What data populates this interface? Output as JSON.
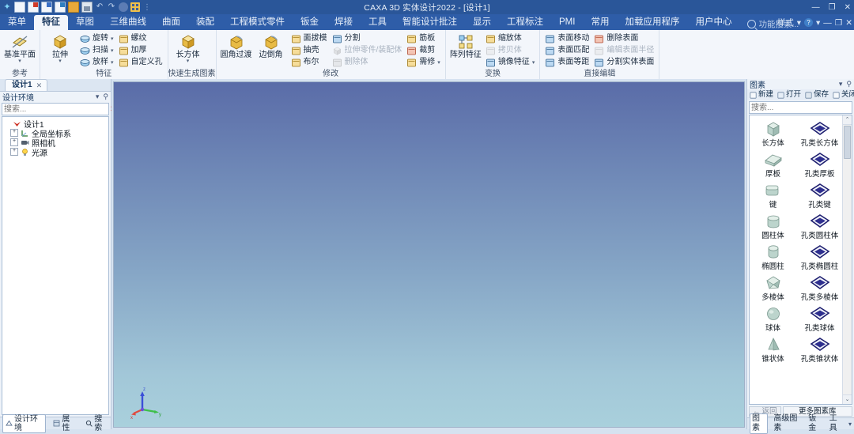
{
  "titlebar": {
    "app_title": "CAXA 3D 实体设计2022 - [设计1]",
    "quick_access": [
      {
        "name": "app-logo-icon",
        "label": "CAXA"
      },
      {
        "name": "new-document-icon",
        "label": "新建"
      },
      {
        "name": "new-part-red-icon",
        "label": "新建零件"
      },
      {
        "name": "new-drawing-icon",
        "label": "新建图纸"
      },
      {
        "name": "new-assembly-icon",
        "label": "新建装配"
      },
      {
        "name": "open-icon",
        "label": "打开"
      },
      {
        "name": "save-icon",
        "label": "保存"
      },
      {
        "name": "undo-icon",
        "label": "撤销"
      },
      {
        "name": "redo-icon",
        "label": "重做"
      },
      {
        "name": "sphere-icon",
        "label": "渲染"
      },
      {
        "name": "grid-icon",
        "label": "栅格"
      },
      {
        "name": "customize-qat-icon",
        "label": "自定义快速访问工具栏"
      }
    ],
    "window_controls": {
      "minimize": "—",
      "maximize": "❐",
      "close": "✕"
    }
  },
  "ribbon_tabs": {
    "items": [
      {
        "label": "菜单",
        "active": false
      },
      {
        "label": "特征",
        "active": true
      },
      {
        "label": "草图",
        "active": false
      },
      {
        "label": "三维曲线",
        "active": false
      },
      {
        "label": "曲面",
        "active": false
      },
      {
        "label": "装配",
        "active": false
      },
      {
        "label": "工程模式零件",
        "active": false
      },
      {
        "label": "钣金",
        "active": false
      },
      {
        "label": "焊接",
        "active": false
      },
      {
        "label": "工具",
        "active": false
      },
      {
        "label": "智能设计批注",
        "active": false
      },
      {
        "label": "显示",
        "active": false
      },
      {
        "label": "工程标注",
        "active": false
      },
      {
        "label": "PMI",
        "active": false
      },
      {
        "label": "常用",
        "active": false
      },
      {
        "label": "加载应用程序",
        "active": false
      },
      {
        "label": "用户中心",
        "active": false
      }
    ],
    "function_search_placeholder": "功能搜索...",
    "style_label": "样式",
    "style_caret": "▾",
    "help_glyph": "?",
    "help_caret": "▾",
    "min_glyph": "—",
    "restore_glyph": "❐",
    "close_glyph": "✕"
  },
  "ribbon_groups": [
    {
      "caption": "参考",
      "big": [
        {
          "label": "基准平面",
          "icon": "datum-plane-icon",
          "caret": "▾"
        }
      ],
      "small": []
    },
    {
      "caption": "特征",
      "big": [
        {
          "label": "拉伸",
          "icon": "extrude-icon",
          "caret": "▾"
        }
      ],
      "small": [
        [
          {
            "label": "旋转",
            "icon": "revolve-icon",
            "caret": "▾",
            "disabled": false
          },
          {
            "label": "螺纹",
            "icon": "thread-icon",
            "caret": "",
            "disabled": false
          }
        ],
        [
          {
            "label": "扫描",
            "icon": "sweep-icon",
            "caret": "▾",
            "disabled": false
          },
          {
            "label": "加厚",
            "icon": "thicken-icon",
            "caret": "",
            "disabled": false
          }
        ],
        [
          {
            "label": "放样",
            "icon": "loft-icon",
            "caret": "▾",
            "disabled": false
          },
          {
            "label": "自定义孔",
            "icon": "custom-hole-icon",
            "caret": "",
            "disabled": false
          }
        ]
      ]
    },
    {
      "caption": "快速生成图素",
      "big": [
        {
          "label": "长方体",
          "icon": "box-primitive-icon",
          "caret": "▾"
        }
      ],
      "small": []
    },
    {
      "caption": "修改",
      "big": [
        {
          "label": "圆角过渡",
          "icon": "fillet-icon",
          "caret": ""
        },
        {
          "label": "边倒角",
          "icon": "chamfer-icon",
          "caret": ""
        }
      ],
      "small": [
        [
          {
            "label": "面拔模",
            "icon": "draft-face-icon",
            "disabled": false
          },
          {
            "label": "分割",
            "icon": "split-icon",
            "disabled": false
          },
          {
            "label": "筋板",
            "icon": "rib-icon",
            "disabled": false
          }
        ],
        [
          {
            "label": "抽壳",
            "icon": "shell-icon",
            "disabled": false
          },
          {
            "label": "拉伸零件/装配体",
            "icon": "extrude-part-icon",
            "disabled": true
          },
          {
            "label": "裁剪",
            "icon": "trim-icon",
            "disabled": false
          }
        ],
        [
          {
            "label": "布尔",
            "icon": "boolean-icon",
            "disabled": false
          },
          {
            "label": "删除体",
            "icon": "delete-body-icon",
            "disabled": true
          },
          {
            "label": "需修",
            "icon": "repair-icon",
            "caret": "▾",
            "disabled": false
          }
        ]
      ]
    },
    {
      "caption": "变换",
      "big": [
        {
          "label": "阵列特征",
          "icon": "pattern-feature-icon",
          "caret": ""
        }
      ],
      "small": [
        [
          {
            "label": "缩放体",
            "icon": "scale-body-icon",
            "disabled": false
          }
        ],
        [
          {
            "label": "拷贝体",
            "icon": "copy-body-icon",
            "disabled": true
          }
        ],
        [
          {
            "label": "镜像特征",
            "icon": "mirror-feature-icon",
            "caret": "▾",
            "disabled": false
          }
        ]
      ]
    },
    {
      "caption": "直接编辑",
      "big": [],
      "small": [
        [
          {
            "label": "表面移动",
            "icon": "move-face-icon",
            "disabled": false
          },
          {
            "label": "删除表面",
            "icon": "delete-face-icon",
            "disabled": false
          }
        ],
        [
          {
            "label": "表面匹配",
            "icon": "match-face-icon",
            "disabled": false
          },
          {
            "label": "编辑表面半径",
            "icon": "edit-face-radius-icon",
            "disabled": true
          }
        ],
        [
          {
            "label": "表面等距",
            "icon": "offset-face-icon",
            "disabled": false
          },
          {
            "label": "分割实体表面",
            "icon": "split-solid-face-icon",
            "disabled": false
          }
        ]
      ]
    }
  ],
  "left_panel": {
    "doc_tab": {
      "label": "设计1",
      "close_glyph": "✕"
    },
    "header": {
      "title": "设计环境",
      "caret": "▾",
      "pin": "⚲"
    },
    "search": {
      "placeholder": "搜索...",
      "value": "",
      "clear_glyph": "✕",
      "filter_glyph": "⚘"
    },
    "tree": [
      {
        "label": "设计1",
        "icon": "design-root-icon",
        "level": 0,
        "expander": ""
      },
      {
        "label": "全局坐标系",
        "icon": "global-csys-icon",
        "level": 1,
        "expander": "+"
      },
      {
        "label": "照相机",
        "icon": "camera-icon",
        "level": 1,
        "expander": "+"
      },
      {
        "label": "光源",
        "icon": "light-source-icon",
        "level": 1,
        "expander": "+"
      }
    ],
    "bottom_tabs": [
      {
        "label": "设计环境",
        "icon": "design-env-icon",
        "active": true
      },
      {
        "label": "属性",
        "icon": "properties-icon",
        "active": false
      },
      {
        "label": "搜索",
        "icon": "search-icon",
        "active": false
      }
    ]
  },
  "viewport": {
    "gradient_top": "#5a6ca8",
    "gradient_bottom": "#a9d0dc",
    "axis_labels": {
      "x": "x",
      "y": "y",
      "z": "z"
    },
    "axis_colors": {
      "x": "#e04a3f",
      "y": "#3fbf4a",
      "z": "#3a4fd8"
    }
  },
  "right_panel": {
    "header": {
      "title": "图素",
      "caret": "▾",
      "pin": "⚲"
    },
    "buttons": [
      {
        "label": "新建",
        "icon": "new-icon"
      },
      {
        "label": "打开",
        "icon": "open-icon"
      },
      {
        "label": "保存",
        "icon": "save-icon"
      },
      {
        "label": "关闭",
        "icon": "close-icon"
      }
    ],
    "search": {
      "placeholder": "搜索...",
      "value": "",
      "clear_glyph": "✕"
    },
    "gallery": [
      [
        {
          "label": "长方体",
          "icon": "box-shape-icon",
          "kind": "solid"
        },
        {
          "label": "孔类长方体",
          "icon": "hole-box-shape-icon",
          "kind": "hole"
        }
      ],
      [
        {
          "label": "厚板",
          "icon": "plate-shape-icon",
          "kind": "solid"
        },
        {
          "label": "孔类厚板",
          "icon": "hole-plate-shape-icon",
          "kind": "hole"
        }
      ],
      [
        {
          "label": "键",
          "icon": "key-shape-icon",
          "kind": "solid"
        },
        {
          "label": "孔类键",
          "icon": "hole-key-shape-icon",
          "kind": "hole"
        }
      ],
      [
        {
          "label": "圆柱体",
          "icon": "cylinder-shape-icon",
          "kind": "solid"
        },
        {
          "label": "孔类圆柱体",
          "icon": "hole-cylinder-shape-icon",
          "kind": "hole"
        }
      ],
      [
        {
          "label": "椭圆柱",
          "icon": "ellipse-cylinder-shape-icon",
          "kind": "solid"
        },
        {
          "label": "孔类椭圆柱",
          "icon": "hole-ellipse-cylinder-shape-icon",
          "kind": "hole"
        }
      ],
      [
        {
          "label": "多棱体",
          "icon": "polyhedron-shape-icon",
          "kind": "solid"
        },
        {
          "label": "孔类多棱体",
          "icon": "hole-polyhedron-shape-icon",
          "kind": "hole"
        }
      ],
      [
        {
          "label": "球体",
          "icon": "sphere-shape-icon",
          "kind": "solid"
        },
        {
          "label": "孔类球体",
          "icon": "hole-sphere-shape-icon",
          "kind": "hole"
        }
      ],
      [
        {
          "label": "锥状体",
          "icon": "cone-shape-icon",
          "kind": "solid"
        },
        {
          "label": "孔类锥状体",
          "icon": "hole-cone-shape-icon",
          "kind": "hole"
        }
      ]
    ],
    "nav": {
      "back_label": "返回",
      "back_arrow": "←",
      "more_label": "更多图素库"
    },
    "tabs": [
      {
        "label": "图素",
        "active": true
      },
      {
        "label": "高级图素",
        "active": false
      },
      {
        "label": "钣金",
        "active": false
      },
      {
        "label": "工具",
        "active": false
      }
    ],
    "tabs_caret": "▾",
    "scrollbar": {
      "up_glyph": "⌃",
      "down_glyph": "⌄"
    }
  }
}
